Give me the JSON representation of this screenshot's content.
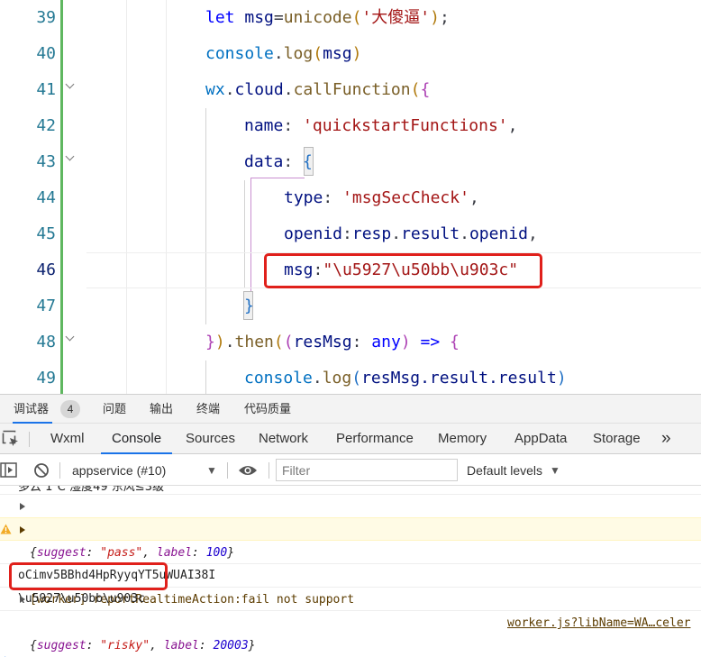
{
  "editor": {
    "lines": [
      {
        "num": "39"
      },
      {
        "num": "40"
      },
      {
        "num": "41"
      },
      {
        "num": "42"
      },
      {
        "num": "43"
      },
      {
        "num": "44"
      },
      {
        "num": "45"
      },
      {
        "num": "46"
      },
      {
        "num": "47"
      },
      {
        "num": "48"
      },
      {
        "num": "49"
      }
    ],
    "t": {
      "l39_kw": "let",
      "l39_var": " msg",
      "l39_eq": "=",
      "l39_fn": "unicode",
      "l39_op": "(",
      "l39_str": "'大傻逼'",
      "l39_cp": ")",
      "l39_end": ";",
      "l40_obj": "console",
      "l40_dot": ".",
      "l40_fn": "log",
      "l40_op": "(",
      "l40_arg": "msg",
      "l40_cp": ")",
      "l41_obj": "wx",
      "l41_d1": ".",
      "l41_prop": "cloud",
      "l41_d2": ".",
      "l41_fn": "callFunction",
      "l41_op": "(",
      "l41_ob": "{",
      "l42_key": "name",
      "l42_col": ": ",
      "l42_str": "'quickstartFunctions'",
      "l42_com": ",",
      "l43_key": "data",
      "l43_col": ": ",
      "l43_ob": "{",
      "l44_key": "type",
      "l44_col": ": ",
      "l44_str": "'msgSecCheck'",
      "l44_com": ",",
      "l45_key": "openid",
      "l45_col": ":",
      "l45_v1": "resp",
      "l45_d1": ".",
      "l45_v2": "result",
      "l45_d2": ".",
      "l45_v3": "openid",
      "l45_com": ",",
      "l46_key": "msg",
      "l46_col": ":",
      "l46_str": "\"\\u5927\\u50bb\\u903c\"",
      "l47_cb": "}",
      "l48_cb": "}",
      "l48_cp": ")",
      "l48_dot": ".",
      "l48_fn": "then",
      "l48_o1": "(",
      "l48_o2": "(",
      "l48_param": "resMsg",
      "l48_col": ": ",
      "l48_type": "any",
      "l48_cp2": ")",
      "l48_arrow": " => ",
      "l48_ob": "{",
      "l49_obj": "console",
      "l49_dot": ".",
      "l49_fn": "log",
      "l49_op": "(",
      "l49_arg": "resMsg.result.result",
      "l49_cp": ")"
    }
  },
  "devtools": {
    "top_tabs": [
      {
        "label": "调试器",
        "badge": "4"
      },
      {
        "label": "问题"
      },
      {
        "label": "输出"
      },
      {
        "label": "终端"
      },
      {
        "label": "代码质量"
      }
    ],
    "panel_tabs": [
      "Wxml",
      "Console",
      "Sources",
      "Network",
      "Performance",
      "Memory",
      "AppData",
      "Storage"
    ],
    "active_panel": "Console",
    "more": "»",
    "context": "appservice (#10)",
    "filter_placeholder": "Filter",
    "levels": "Default levels"
  },
  "console": {
    "weather": "多云 1℃ 湿度49 东风≤3级",
    "r1": {
      "open": "{",
      "k1": "suggest",
      "c1": ": ",
      "v1": "\"pass\"",
      "sep": ", ",
      "k2": "label",
      "c2": ": ",
      "v2": "100",
      "close": "}"
    },
    "warn_text": "[worker] reportRealtimeAction:fail not support",
    "warn_link": "worker.js?libName=WA…celer",
    "openid": "oCimv5BBhd4HpRyyqYT5uWUAI38I",
    "unicode": "\\u5927\\u50bb\\u903c",
    "r2": {
      "open": "{",
      "k1": "suggest",
      "c1": ": ",
      "v1": "\"risky\"",
      "sep": ", ",
      "k2": "label",
      "c2": ": ",
      "v2": "20003",
      "close": "}"
    },
    "prompt": "›"
  },
  "colors": {
    "highlight": "#e0201b",
    "active_tab": "#1a73e8",
    "warning_bg": "#fffbe5",
    "gutter_bar": "#5fb760"
  }
}
